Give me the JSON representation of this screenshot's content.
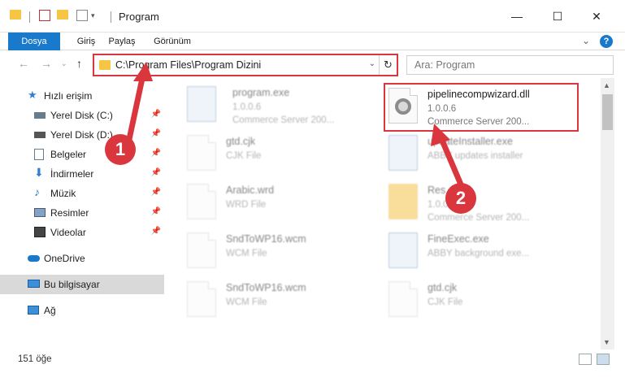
{
  "window": {
    "title": "Program",
    "minimize": "—",
    "maximize": "☐",
    "close": "✕"
  },
  "ribbon": {
    "tabs": [
      "Dosya",
      "Giriş",
      "Paylaş",
      "Görünüm"
    ],
    "help": "?"
  },
  "address": {
    "path": "C:\\Program Files\\Program Dizini",
    "search_placeholder": "Ara: Program"
  },
  "sidebar": {
    "quick_access": "Hızlı erişim",
    "items": [
      {
        "label": "Yerel Disk (C:)",
        "icon": "drive-icon",
        "pinned": true
      },
      {
        "label": "Yerel Disk (D:)",
        "icon": "drive-icon",
        "pinned": true
      },
      {
        "label": "Belgeler",
        "icon": "documents-icon",
        "pinned": true
      },
      {
        "label": "İndirmeler",
        "icon": "download-icon",
        "pinned": true
      },
      {
        "label": "Müzik",
        "icon": "music-icon",
        "pinned": true
      },
      {
        "label": "Resimler",
        "icon": "pictures-icon",
        "pinned": true
      },
      {
        "label": "Videolar",
        "icon": "videos-icon",
        "pinned": true
      }
    ],
    "onedrive": "OneDrive",
    "this_pc": "Bu bilgisayar",
    "network": "Ağ"
  },
  "files": {
    "highlighted": {
      "name": "pipelinecompwizard.dll",
      "version": "1.0.0.6",
      "description": "Commerce Server 200..."
    },
    "others": [
      {
        "name": "program.exe",
        "line2": "1.0.0.6",
        "line3": "Commerce Server 200..."
      },
      {
        "name": "gtd.cjk",
        "line2": "CJK File",
        "line3": ""
      },
      {
        "name": "updateInstaller.exe",
        "line2": "ABBY updates installer",
        "line3": ""
      },
      {
        "name": "Arabic.wrd",
        "line2": "WRD File",
        "line3": ""
      },
      {
        "name": "Res",
        "line2": "1.0.0.6",
        "line3": "Commerce Server 200..."
      },
      {
        "name": "SndToWP16.wcm",
        "line2": "WCM File",
        "line3": ""
      },
      {
        "name": "FineExec.exe",
        "line2": "ABBY background exe...",
        "line3": ""
      },
      {
        "name": "SndToWP16.wcm",
        "line2": "WCM File",
        "line3": ""
      },
      {
        "name": "gtd.cjk",
        "line2": "CJK File",
        "line3": ""
      }
    ]
  },
  "status": {
    "count": "151 öğe"
  },
  "callouts": [
    "1",
    "2"
  ],
  "colors": {
    "accent": "#1979ca",
    "highlight": "#d9363e"
  }
}
